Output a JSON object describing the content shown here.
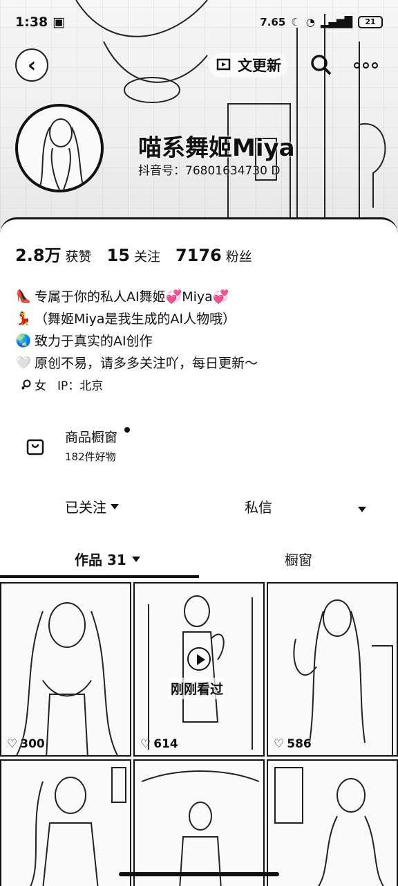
{
  "status_bar": {
    "time": "1:38",
    "network_speed": "7.65",
    "battery": "21",
    "icons": [
      "gallery-icon",
      "moon-icon",
      "wifi-icon",
      "signal-icon",
      "battery-icon"
    ]
  },
  "header": {
    "back_icon": "chevron-left-icon",
    "update_label": "文更新",
    "search_icon": "search-icon",
    "more_icon": "more-icon"
  },
  "profile": {
    "nickname": "喵系舞姬Miya",
    "douyin_id": "抖音号：76801634730 D"
  },
  "stats": [
    {
      "num": "2.8万",
      "label": "获赞"
    },
    {
      "num": "15",
      "label": "关注"
    },
    {
      "num": "7176",
      "label": "粉丝"
    }
  ],
  "bio": [
    {
      "emoji": "👠",
      "text": "专属于你的私人AI舞姬💞Miya💞"
    },
    {
      "emoji": "💃",
      "text": "（舞姬Miya是我生成的AI人物哦）"
    },
    {
      "emoji": "🌏",
      "text": "致力于真实的AI创作"
    },
    {
      "emoji": "🤍",
      "text": "原创不易，请多多关注吖，每日更新～"
    }
  ],
  "meta": {
    "gender_icon": "female-icon",
    "gender": "女",
    "ip": "IP：北京"
  },
  "shop": {
    "title": "商品橱窗",
    "subtitle": "182件好物"
  },
  "actions": {
    "followed": "已关注",
    "message": "私信"
  },
  "tabs": {
    "works": "作品 31",
    "showcase": "橱窗"
  },
  "grid": [
    {
      "likes": "300"
    },
    {
      "likes": "614",
      "badge": "刚刚看过"
    },
    {
      "likes": "586"
    },
    {
      "likes": ""
    },
    {
      "likes": ""
    },
    {
      "likes": ""
    }
  ],
  "colors": {
    "ink": "#111111",
    "paper": "#ffffff"
  }
}
